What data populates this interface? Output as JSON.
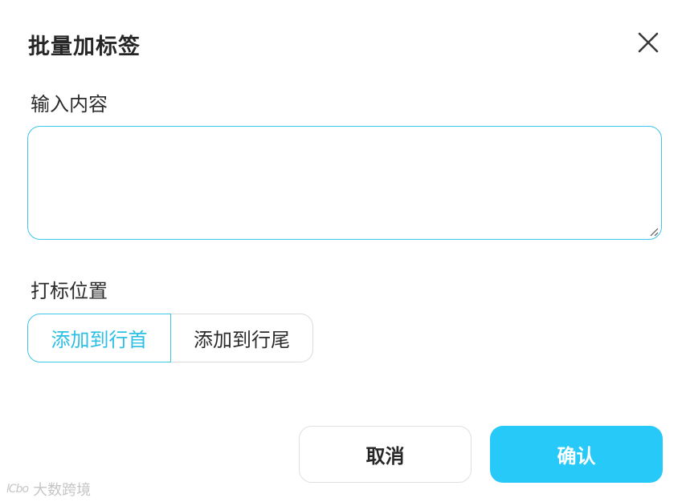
{
  "dialog": {
    "title": "批量加标签",
    "close_icon": "close-icon"
  },
  "content_section": {
    "label": "输入内容",
    "textarea_value": "",
    "textarea_placeholder": ""
  },
  "position_section": {
    "label": "打标位置",
    "options": [
      {
        "label": "添加到行首",
        "selected": true
      },
      {
        "label": "添加到行尾",
        "selected": false
      }
    ]
  },
  "footer": {
    "cancel_label": "取消",
    "confirm_label": "确认"
  },
  "watermark": {
    "logo": "lCbo",
    "text": "大数跨境"
  },
  "colors": {
    "accent": "#26c9f7",
    "border_active": "#3cc6e8",
    "text_selected": "#2bbfe5"
  }
}
